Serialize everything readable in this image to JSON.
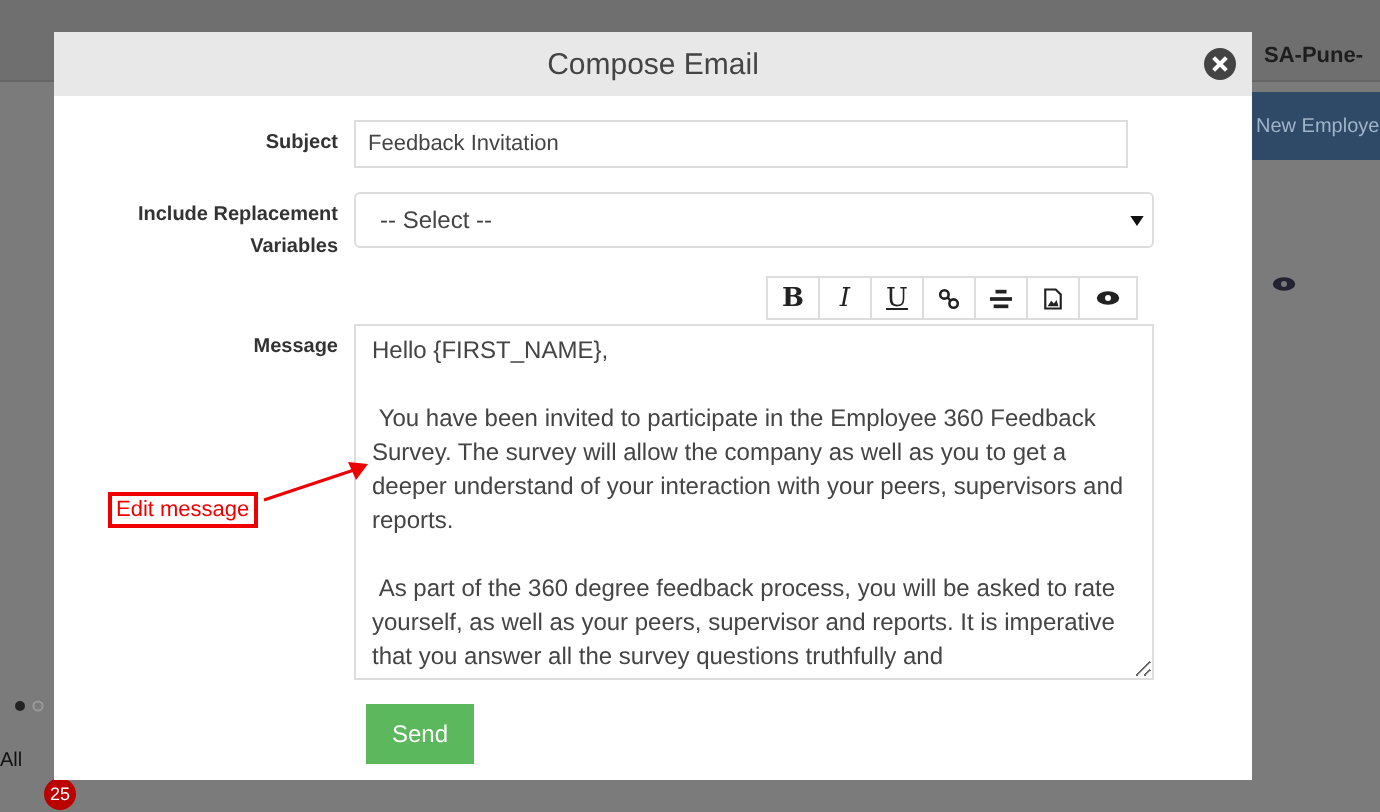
{
  "background": {
    "location": "SA-Pune-",
    "new_button": "New Employe",
    "filter": "All",
    "badge": "25"
  },
  "dialog": {
    "title": "Compose Email",
    "subject": {
      "label": "Subject",
      "value": "Feedback Invitation"
    },
    "variables": {
      "label": "Include Replacement Variables",
      "value": "-- Select --"
    },
    "toolbar": [
      {
        "kind": "bold",
        "label": "B"
      },
      {
        "kind": "italic",
        "label": "I"
      },
      {
        "kind": "underline",
        "label": "U"
      },
      {
        "kind": "link"
      },
      {
        "kind": "align"
      },
      {
        "kind": "image"
      },
      {
        "kind": "preview"
      }
    ],
    "message": {
      "label": "Message",
      "paragraphs": [
        "Hello {FIRST_NAME},",
        " You have been invited to participate in the Employee 360 Feedback Survey. The survey will allow the company as well as you to get a deeper understand of your interaction with your peers, supervisors and reports.",
        " As part of the 360 degree feedback process, you will be asked to rate yourself, as well as your peers, supervisor and reports. It is imperative that you answer all the survey questions truthfully and"
      ]
    },
    "send": "Send",
    "annotation": "Edit message"
  }
}
